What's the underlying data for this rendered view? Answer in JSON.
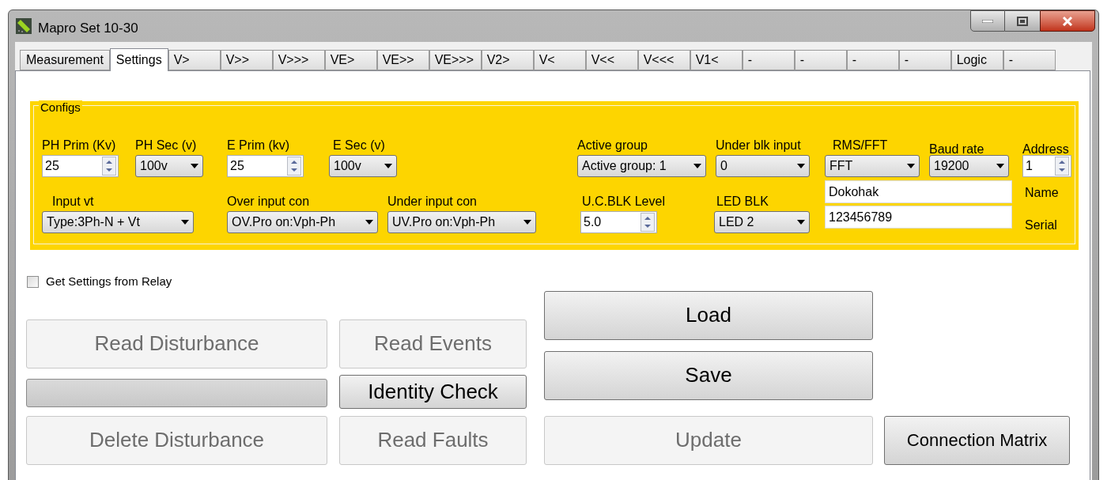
{
  "window": {
    "title": "Mapro Set 10-30"
  },
  "tabs": [
    {
      "label": "Measurement",
      "selected": false
    },
    {
      "label": "Settings",
      "selected": true
    },
    {
      "label": "V>",
      "selected": false
    },
    {
      "label": "V>>",
      "selected": false
    },
    {
      "label": "V>>>",
      "selected": false
    },
    {
      "label": "VE>",
      "selected": false
    },
    {
      "label": "VE>>",
      "selected": false
    },
    {
      "label": "VE>>>",
      "selected": false
    },
    {
      "label": "V2>",
      "selected": false
    },
    {
      "label": "V<",
      "selected": false
    },
    {
      "label": "V<<",
      "selected": false
    },
    {
      "label": "V<<<",
      "selected": false
    },
    {
      "label": "V1<",
      "selected": false
    },
    {
      "label": "-",
      "selected": false
    },
    {
      "label": "-",
      "selected": false
    },
    {
      "label": "-",
      "selected": false
    },
    {
      "label": "-",
      "selected": false
    },
    {
      "label": "Logic",
      "selected": false
    },
    {
      "label": "-",
      "selected": false
    }
  ],
  "configs": {
    "title": "Configs",
    "row_1": [
      {
        "kind": "spin",
        "label": "PH Prim (Kv)",
        "value": "25"
      },
      {
        "kind": "combo",
        "label": "PH Sec (v)",
        "value": "100v"
      },
      {
        "kind": "spin",
        "label": "E Prim (kv)",
        "value": "25"
      },
      {
        "kind": "combo",
        "label": "E Sec (v)",
        "value": "100v"
      },
      {
        "kind": "combo",
        "label": "Active group",
        "value": "Active group: 1"
      },
      {
        "kind": "combo",
        "label": "Under blk input",
        "value": "0"
      },
      {
        "kind": "combo",
        "label": "RMS/FFT",
        "value": "FFT"
      },
      {
        "kind": "combo",
        "label": "Baud rate",
        "value": "19200"
      },
      {
        "kind": "spin",
        "label": "Address",
        "value": "1"
      }
    ],
    "row_2": [
      {
        "kind": "combo",
        "label": "Input vt",
        "value": "Type:3Ph-N + Vt"
      },
      {
        "kind": "combo",
        "label": "Over input con",
        "value": "OV.Pro on:Vph-Ph"
      },
      {
        "kind": "combo",
        "label": "Under input con",
        "value": "UV.Pro on:Vph-Ph"
      },
      {
        "kind": "spin",
        "label": "U.C.BLK Level",
        "value": "5.0"
      },
      {
        "kind": "combo",
        "label": "LED BLK",
        "value": "LED 2"
      }
    ],
    "text_fields": [
      {
        "label": "Name",
        "value": "Dokohak"
      },
      {
        "label": "Serial",
        "value": "123456789"
      }
    ]
  },
  "checkbox": {
    "label": "Get Settings from Relay",
    "checked": false
  },
  "disturbance_buttons": [
    {
      "label": "Read Disturbance",
      "disabled": true
    },
    {
      "label": "Delete Disturbance",
      "disabled": true
    }
  ],
  "progress": {
    "level": 0
  },
  "record_buttons": [
    {
      "label": "Read Events",
      "disabled": true
    },
    {
      "label": "Identity Check",
      "disabled": false
    },
    {
      "label": "Read Faults",
      "disabled": true
    }
  ],
  "file_buttons": [
    {
      "label": "Load",
      "disabled": false
    },
    {
      "label": "Save",
      "disabled": false
    },
    {
      "label": "Update",
      "disabled": true
    }
  ],
  "connection_button": {
    "label": "Connection Matrix",
    "disabled": false
  }
}
